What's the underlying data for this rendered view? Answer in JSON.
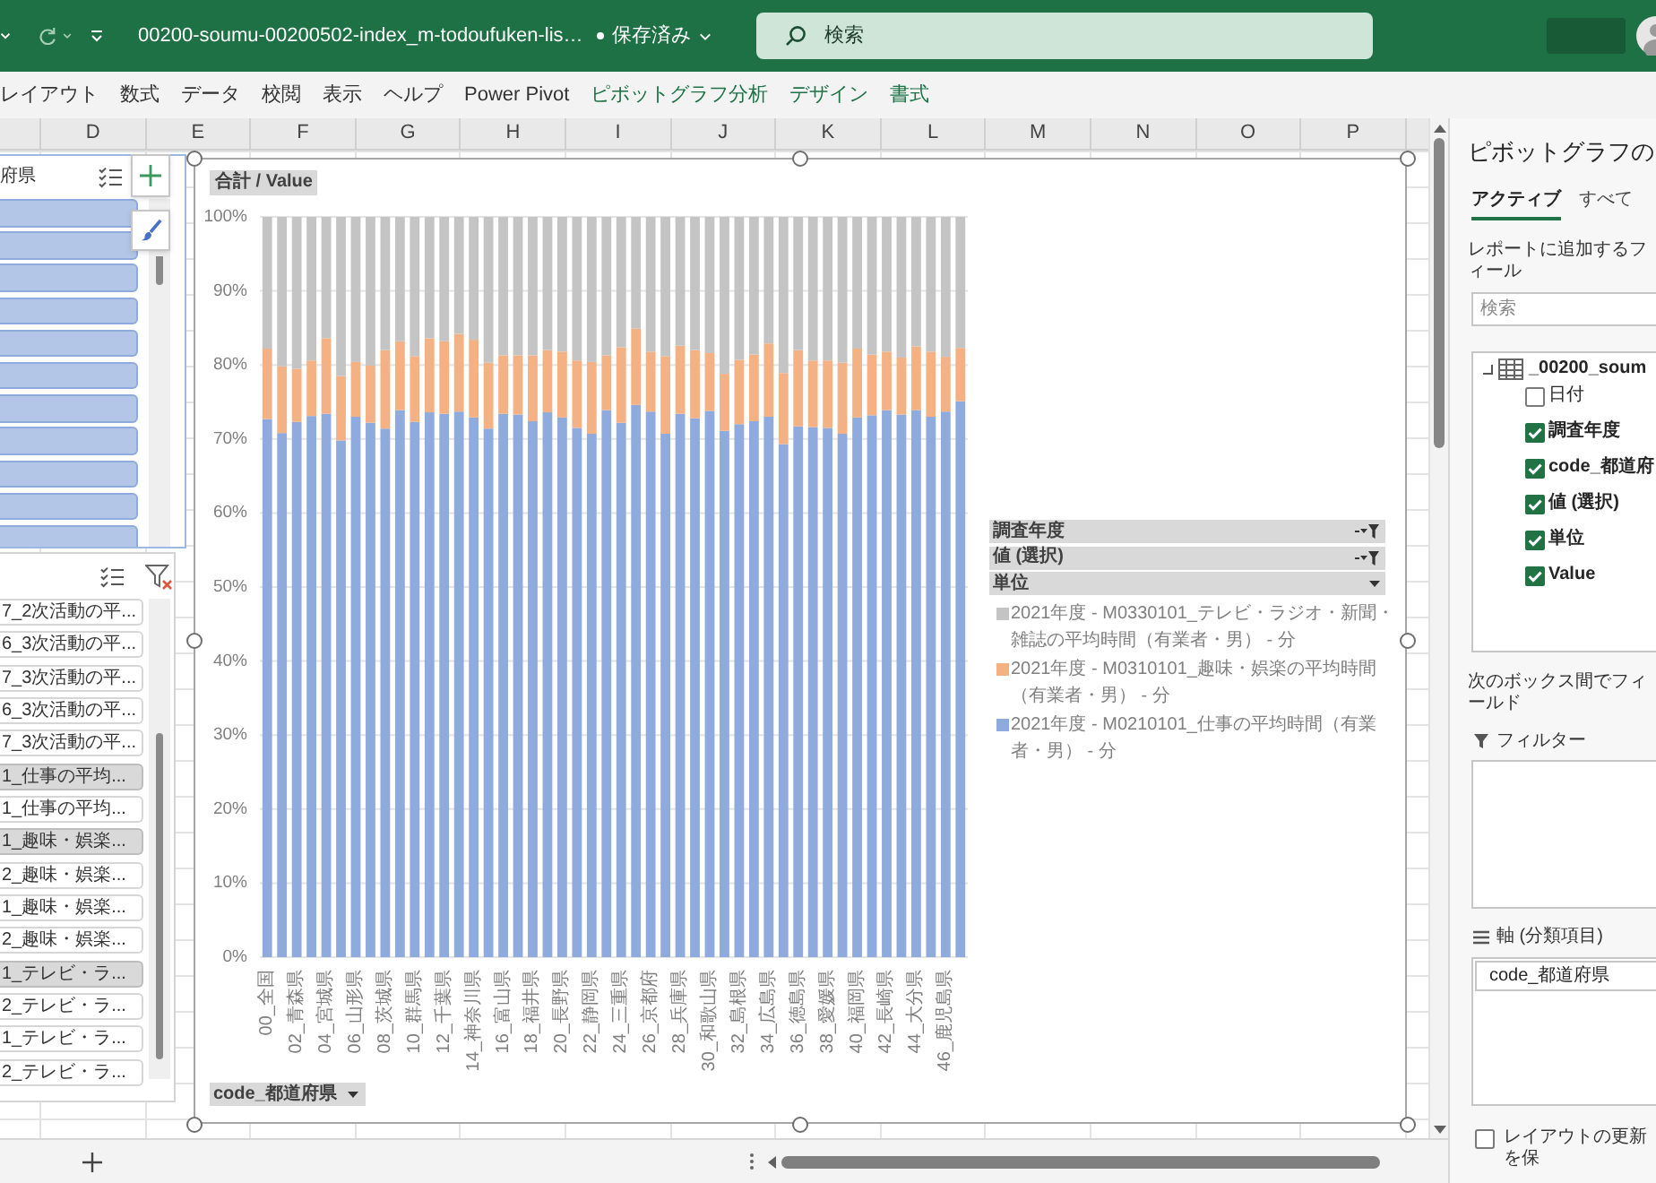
{
  "title_bar": {
    "title": "00200-soumu-00200502-index_m-todoufuken-lis…",
    "save_status": "保存済み",
    "search": {
      "placeholder": "検索"
    }
  },
  "ribbon_tabs": [
    {
      "label": "レイアウト",
      "kind": "standard"
    },
    {
      "label": "数式",
      "kind": "standard"
    },
    {
      "label": "データ",
      "kind": "standard"
    },
    {
      "label": "校閲",
      "kind": "standard"
    },
    {
      "label": "表示",
      "kind": "standard"
    },
    {
      "label": "ヘルプ",
      "kind": "standard"
    },
    {
      "label": "Power Pivot",
      "kind": "standard"
    },
    {
      "label": "ピボットグラフ分析",
      "kind": "contextual"
    },
    {
      "label": "デザイン",
      "kind": "contextual"
    },
    {
      "label": "書式",
      "kind": "contextual"
    }
  ],
  "columns": [
    "D",
    "E",
    "F",
    "G",
    "H",
    "I",
    "J",
    "K",
    "L",
    "M",
    "N",
    "O",
    "P"
  ],
  "slicers": [
    {
      "header": "府県",
      "items": [
        {
          "selected": true
        },
        {
          "selected": true
        },
        {
          "selected": true
        },
        {
          "selected": true
        },
        {
          "selected": true
        },
        {
          "selected": true
        },
        {
          "selected": true
        },
        {
          "selected": true
        },
        {
          "selected": true
        },
        {
          "selected": true
        },
        {
          "selected": true
        }
      ]
    },
    {
      "items": [
        {
          "label": "7_2次活動の平...",
          "selected": false
        },
        {
          "label": "6_3次活動の平...",
          "selected": false
        },
        {
          "label": "7_3次活動の平...",
          "selected": false
        },
        {
          "label": "6_3次活動の平...",
          "selected": false
        },
        {
          "label": "7_3次活動の平...",
          "selected": false
        },
        {
          "label": "1_仕事の平均...",
          "selected": true
        },
        {
          "label": "1_仕事の平均...",
          "selected": false
        },
        {
          "label": "1_趣味・娯楽...",
          "selected": true
        },
        {
          "label": "2_趣味・娯楽...",
          "selected": false
        },
        {
          "label": "1_趣味・娯楽...",
          "selected": false
        },
        {
          "label": "2_趣味・娯楽...",
          "selected": false
        },
        {
          "label": "1_テレビ・ラ...",
          "selected": true
        },
        {
          "label": "2_テレビ・ラ...",
          "selected": false
        },
        {
          "label": "1_テレビ・ラ...",
          "selected": false
        },
        {
          "label": "2_テレビ・ラ...",
          "selected": false
        }
      ]
    }
  ],
  "chart": {
    "value_button": "合計 / Value",
    "legend_buttons": [
      {
        "label": "調査年度",
        "kind": "filter"
      },
      {
        "label": "値 (選択)",
        "kind": "filter"
      },
      {
        "label": "単位",
        "kind": "dropdown"
      }
    ],
    "chart_data": {
      "type": "bar",
      "stacked": true,
      "grid": true,
      "legend": "right",
      "x": [
        0,
        1,
        2,
        3,
        4,
        5,
        6,
        7,
        8,
        9,
        10,
        11,
        12,
        13,
        14,
        15,
        16,
        17,
        18,
        19,
        20,
        21,
        22,
        23,
        24,
        25,
        26,
        27,
        28,
        29,
        30,
        31,
        32,
        33,
        34,
        35,
        36,
        37,
        38,
        39,
        40,
        41,
        42,
        43,
        44,
        45,
        46,
        47
      ],
      "xlim": [
        -0.5,
        47.5
      ],
      "xticks": [
        {
          "value": 0,
          "label": "00_全国"
        },
        {
          "value": 2,
          "label": "02_青森県"
        },
        {
          "value": 4,
          "label": "04_宮城県"
        },
        {
          "value": 6,
          "label": "06_山形県"
        },
        {
          "value": 8,
          "label": "08_茨城県"
        },
        {
          "value": 10,
          "label": "10_群馬県"
        },
        {
          "value": 12,
          "label": "12_千葉県"
        },
        {
          "value": 14,
          "label": "14_神奈川県"
        },
        {
          "value": 16,
          "label": "16_富山県"
        },
        {
          "value": 18,
          "label": "18_福井県"
        },
        {
          "value": 20,
          "label": "20_長野県"
        },
        {
          "value": 22,
          "label": "22_静岡県"
        },
        {
          "value": 24,
          "label": "24_三重県"
        },
        {
          "value": 26,
          "label": "26_京都府"
        },
        {
          "value": 28,
          "label": "28_兵庫県"
        },
        {
          "value": 30,
          "label": "30_和歌山県"
        },
        {
          "value": 32,
          "label": "32_島根県"
        },
        {
          "value": 34,
          "label": "34_広島県"
        },
        {
          "value": 36,
          "label": "36_徳島県"
        },
        {
          "value": 38,
          "label": "38_愛媛県"
        },
        {
          "value": 40,
          "label": "40_福岡県"
        },
        {
          "value": 42,
          "label": "42_長崎県"
        },
        {
          "value": 44,
          "label": "44_大分県"
        },
        {
          "value": 46,
          "label": "46_鹿児島県"
        }
      ],
      "ylim": [
        0,
        100
      ],
      "yticks": [
        {
          "value": 0,
          "label": "0%"
        },
        {
          "value": 10,
          "label": "10%"
        },
        {
          "value": 20,
          "label": "20%"
        },
        {
          "value": 30,
          "label": "30%"
        },
        {
          "value": 40,
          "label": "40%"
        },
        {
          "value": 50,
          "label": "50%"
        },
        {
          "value": 60,
          "label": "60%"
        },
        {
          "value": 70,
          "label": "70%"
        },
        {
          "value": 80,
          "label": "80%"
        },
        {
          "value": 90,
          "label": "90%"
        },
        {
          "value": 100,
          "label": "100%"
        }
      ],
      "series": [
        {
          "name": "2021年度 - M0210101_仕事の平均時間（有業者・男） - 分",
          "color": "#8faadc",
          "values": [
            72.7,
            70.8,
            72.3,
            73.1,
            73.4,
            69.8,
            73.0,
            72.2,
            71.4,
            73.9,
            72.3,
            73.6,
            73.4,
            73.7,
            72.9,
            71.4,
            73.4,
            73.3,
            72.4,
            73.6,
            72.9,
            71.5,
            70.7,
            73.9,
            72.2,
            74.6,
            73.7,
            70.7,
            73.4,
            72.8,
            73.8,
            71.1,
            72.0,
            72.4,
            73.0,
            69.3,
            71.7,
            71.6,
            71.5,
            70.7,
            72.9,
            73.2,
            73.9,
            73.3,
            73.9,
            73.0,
            73.7,
            75.1
          ]
        },
        {
          "name": "2021年度 - M0310101_趣味・娯楽の平均時間（有業者・男） - 分",
          "color": "#f4b183",
          "values": [
            9.5,
            9.0,
            7.2,
            7.5,
            10.2,
            8.7,
            7.4,
            7.7,
            10.6,
            9.3,
            8.9,
            10.0,
            9.8,
            10.5,
            10.5,
            8.9,
            7.9,
            8.0,
            8.9,
            8.4,
            8.9,
            9.1,
            9.7,
            7.4,
            10.2,
            10.3,
            8.1,
            10.5,
            9.2,
            9.2,
            7.8,
            7.7,
            8.7,
            9.0,
            9.9,
            9.6,
            10.3,
            9.0,
            9.1,
            9.6,
            9.3,
            8.2,
            7.9,
            7.7,
            8.6,
            8.8,
            7.4,
            7.2
          ]
        },
        {
          "name": "2021年度 - M0330101_テレビ・ラジオ・新聞・雑誌の平均時間（有業者・男） - 分",
          "color": "#c4c4c4",
          "values": [
            17.8,
            20.2,
            20.5,
            19.4,
            16.4,
            21.5,
            19.6,
            20.1,
            18.0,
            16.8,
            18.8,
            16.4,
            16.8,
            15.8,
            16.6,
            19.7,
            18.7,
            18.7,
            18.7,
            18.0,
            18.2,
            19.4,
            19.6,
            18.7,
            17.6,
            15.1,
            18.2,
            18.8,
            17.4,
            18.0,
            18.4,
            21.2,
            19.3,
            18.6,
            17.1,
            21.1,
            18.0,
            19.4,
            19.4,
            19.7,
            17.8,
            18.6,
            18.2,
            19.0,
            17.5,
            18.2,
            18.9,
            17.7
          ]
        }
      ]
    },
    "axis_button": "code_都道府県"
  },
  "field_pane": {
    "title": "ピボットグラフの",
    "tabs": [
      {
        "label": "アクティブ",
        "selected": true
      },
      {
        "label": "すべて",
        "selected": false
      }
    ],
    "hint": "レポートに追加するフィール",
    "search": {
      "placeholder": "検索"
    },
    "table": {
      "name": "_00200_soum",
      "expanded": true,
      "children": [
        {
          "label": "日付",
          "checked": false
        },
        {
          "label": "調査年度",
          "checked": true
        },
        {
          "label": "code_都道府",
          "checked": true
        },
        {
          "label": "値 (選択)",
          "checked": true
        },
        {
          "label": "単位",
          "checked": true
        },
        {
          "label": "Value",
          "checked": true
        }
      ]
    },
    "areas_hint": "次のボックス間でフィールド",
    "filter_area": {
      "title": "フィルター"
    },
    "axis_area": {
      "title": "軸 (分類項目)",
      "items": [
        "code_都道府県"
      ]
    },
    "defer_update": {
      "label": "レイアウトの更新を保",
      "checked": false
    }
  }
}
